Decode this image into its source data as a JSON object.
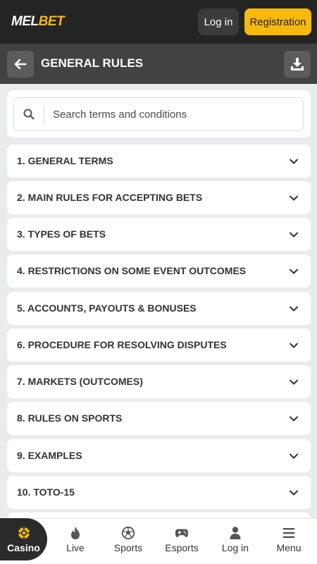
{
  "header": {
    "logo_main": "MEL",
    "logo_accent": "BET",
    "login_label": "Log in",
    "register_label": "Registration"
  },
  "subheader": {
    "title": "GENERAL RULES"
  },
  "search": {
    "placeholder": "Search terms and conditions",
    "value": ""
  },
  "rules": [
    {
      "label": "1. GENERAL TERMS"
    },
    {
      "label": "2. MAIN RULES FOR ACCEPTING BETS"
    },
    {
      "label": "3. TYPES OF BETS"
    },
    {
      "label": "4. RESTRICTIONS ON SOME EVENT OUTCOMES"
    },
    {
      "label": "5. ACCOUNTS, PAYOUTS & BONUSES"
    },
    {
      "label": "6. PROCEDURE FOR RESOLVING DISPUTES"
    },
    {
      "label": "7. MARKETS (OUTCOMES)"
    },
    {
      "label": "8. RULES ON SPORTS"
    },
    {
      "label": "9. EXAMPLES"
    },
    {
      "label": "10. TOTO-15"
    }
  ],
  "bottom_nav": {
    "active": "casino",
    "items": [
      {
        "label": "Casino",
        "icon": "casino-chip-icon"
      },
      {
        "label": "Live",
        "icon": "flame-icon"
      },
      {
        "label": "Sports",
        "icon": "soccer-ball-icon"
      },
      {
        "label": "Esports",
        "icon": "gamepad-icon"
      },
      {
        "label": "Log in",
        "icon": "user-icon"
      },
      {
        "label": "Menu",
        "icon": "hamburger-icon"
      }
    ]
  },
  "colors": {
    "brand_yellow": "#f8b90d",
    "topbar": "#242424",
    "subbar": "#424242",
    "background": "#e9ebee"
  }
}
